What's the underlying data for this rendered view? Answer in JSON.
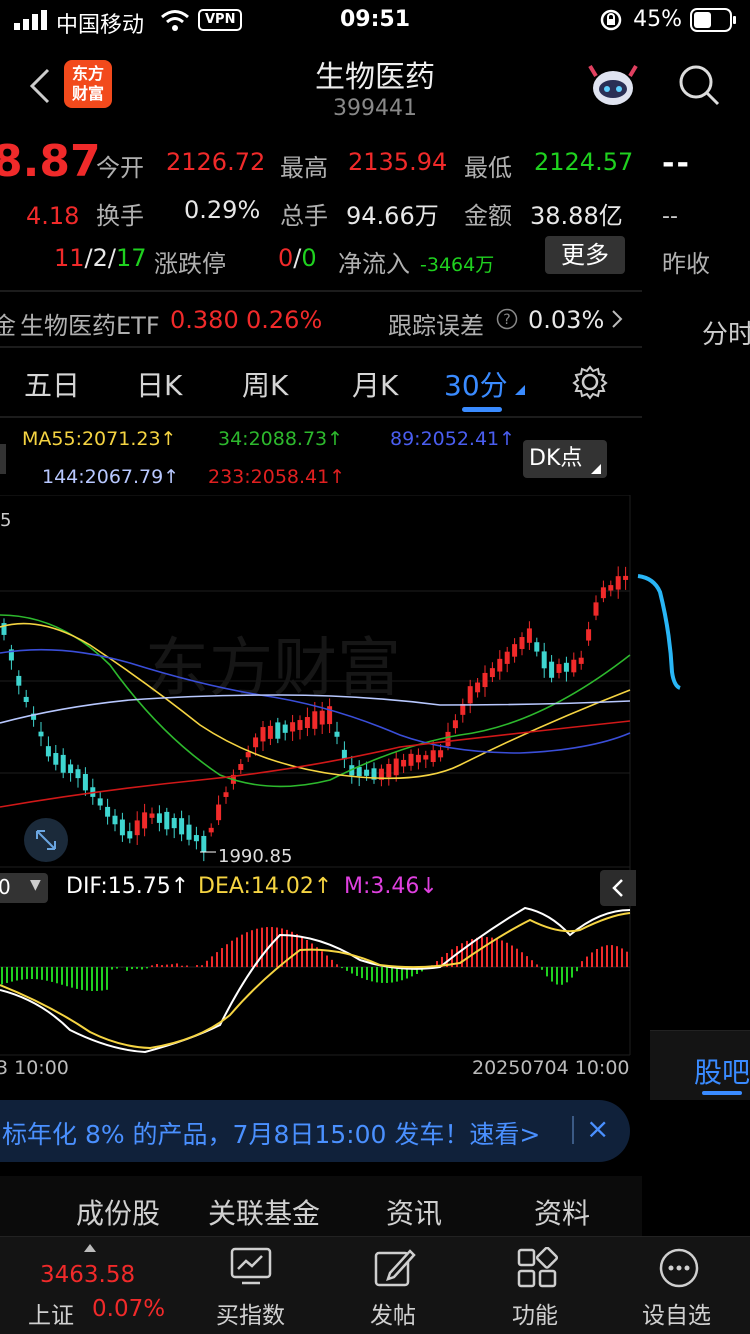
{
  "status": {
    "carrier": "中国移动",
    "vpn": "VPN",
    "time": "09:51",
    "battery": "45%"
  },
  "header": {
    "logo_line1": "东方",
    "logo_line2": "财富",
    "title": "生物医药",
    "code": "399441"
  },
  "quote": {
    "price": "8.87",
    "change": "4.18",
    "open_label": "今开",
    "open": "2126.72",
    "high_label": "最高",
    "high": "2135.94",
    "low_label": "最低",
    "low": "2124.57",
    "turnover_label": "换手",
    "turnover": "0.29%",
    "volume_label": "总手",
    "volume": "94.66万",
    "amount_label": "金额",
    "amount": "38.88亿",
    "adv_a": "11",
    "adv_sep1": "/",
    "adv_b": "2",
    "adv_sep2": "/",
    "adv_c": "17",
    "limit_label": "涨跌停",
    "limit_a": "0",
    "limit_sep": "/",
    "limit_b": "0",
    "inflow_label": "净流入",
    "inflow": "-3464万",
    "more": "更多",
    "right_dash1": "--",
    "right_dash2": "--",
    "prev_close_label": "昨收"
  },
  "etf": {
    "prefix": "金",
    "name": "生物医药ETF",
    "price": "0.380",
    "pct": "0.26%",
    "track_label": "跟踪误差",
    "track_value": "0.03%"
  },
  "right_panel": {
    "fenshi": "分时",
    "guba": "股吧"
  },
  "tabs": [
    "五日",
    "日K",
    "周K",
    "月K",
    "30分"
  ],
  "ma": {
    "ma55": "MA55:2071.23↑",
    "ma34": "34:2088.73↑",
    "ma89": "89:2052.41↑",
    "ma144": "144:2067.79↑",
    "ma233": "233:2058.41↑",
    "dk": "DK点",
    "top_tick": "5",
    "low_label": "1990.85"
  },
  "macd": {
    "selector": "0",
    "dif": "DIF:15.75↑",
    "dea": "DEA:14.02↑",
    "m": "M:3.46↓"
  },
  "time_axis": {
    "left": "3 10:00",
    "right": "20250704 10:00"
  },
  "banner": {
    "text": "标年化 8% 的产品，7月8日15:00 发车！速看>",
    "close": "×"
  },
  "subtabs": [
    "成份股",
    "关联基金",
    "资讯",
    "资料"
  ],
  "bottom": {
    "index_value": "3463.58",
    "index_name": "上证",
    "index_pct": "0.07%",
    "items": [
      "买指数",
      "发帖",
      "功能",
      "设自选"
    ]
  },
  "colors": {
    "up": "#f02a2a",
    "down": "#1fd11f",
    "accent": "#3a8bff",
    "ma55": "#f5d442",
    "ma34": "#2db82d",
    "ma89": "#3a4ed8",
    "ma144": "#b8c8ff",
    "ma233": "#e02020"
  },
  "icons": {
    "back": "chevron-left-icon",
    "search": "search-icon",
    "robot": "robot-avatar-icon",
    "settings": "gear-icon",
    "expand": "expand-icon",
    "collapse": "chevron-left-icon",
    "help": "question-icon"
  }
}
